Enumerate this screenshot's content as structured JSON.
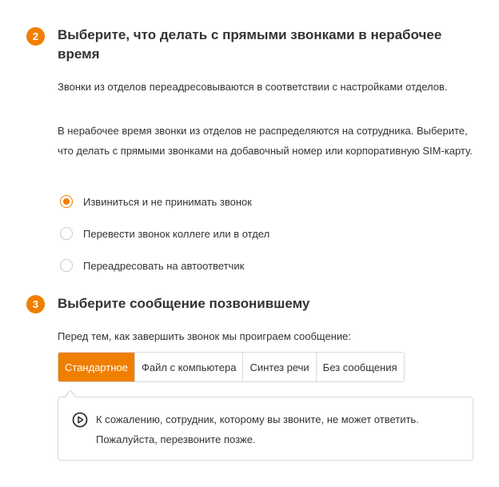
{
  "step2": {
    "number": "2",
    "title": "Выберите, что делать с прямыми звонками в нерабочее время",
    "para1": "Звонки из отделов переадресовываются в соответствии с настройками отделов.",
    "para2": "В нерабочее время звонки из отделов не распределяются на сотрудника. Выберите, что делать с прямыми звонками на добавочный номер или корпоративную SIM-карту.",
    "options": [
      {
        "label": "Извиниться и не принимать звонок",
        "selected": true
      },
      {
        "label": "Перевести звонок коллеге или в отдел",
        "selected": false
      },
      {
        "label": "Переадресовать на автоответчик",
        "selected": false
      }
    ]
  },
  "step3": {
    "number": "3",
    "title": "Выберите сообщение позвонившему",
    "intro": "Перед тем, как завершить звонок мы проиграем сообщение:",
    "tabs": [
      {
        "label": "Стандартное",
        "active": true
      },
      {
        "label": "Файл с компьютера",
        "active": false
      },
      {
        "label": "Синтез речи",
        "active": false
      },
      {
        "label": "Без сообщения",
        "active": false
      }
    ],
    "message": "К сожалению, сотрудник, которому вы звоните, не может ответить. Пожалуйста, перезвоните позже.",
    "play_icon": "play-circle-icon"
  },
  "colors": {
    "accent": "#f07f00",
    "text": "#333333",
    "border": "#d9d9d9",
    "radio_border": "#c8c8c8"
  }
}
